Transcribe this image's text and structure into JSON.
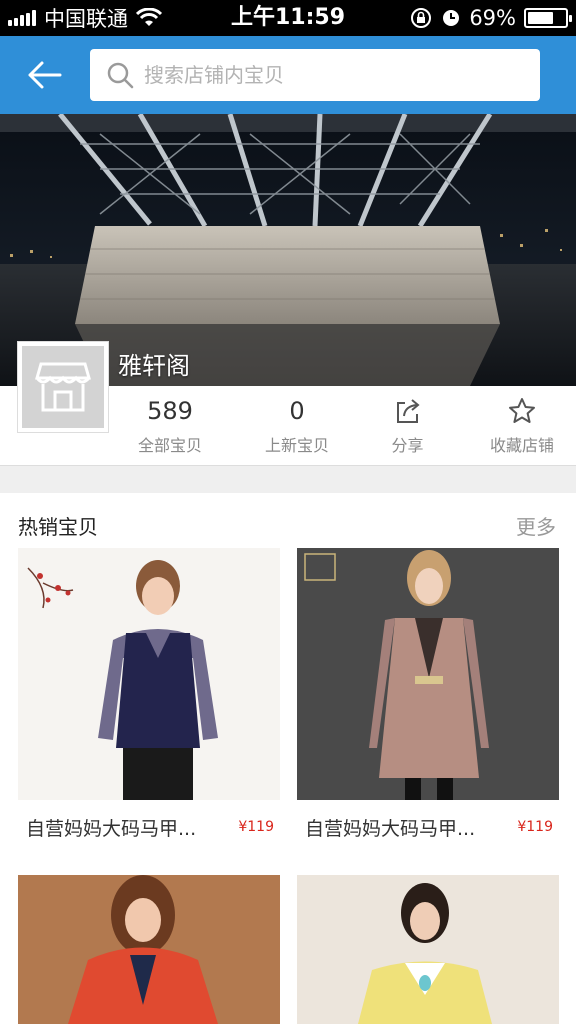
{
  "status_bar": {
    "carrier": "中国联通",
    "time": "上午11:59",
    "battery": "69%",
    "battery_level": 0.69,
    "icons": [
      "signal-icon",
      "wifi-icon",
      "rotation-lock-icon",
      "alarm-icon",
      "battery-icon"
    ]
  },
  "header": {
    "search_placeholder": "搜索店铺内宝贝",
    "colors": {
      "bar": "#2f8fd8"
    }
  },
  "shop": {
    "name": "雅轩阁"
  },
  "stats": [
    {
      "value": "589",
      "label": "全部宝贝"
    },
    {
      "value": "0",
      "label": "上新宝贝"
    },
    {
      "label": "分享",
      "icon": "share-icon"
    },
    {
      "label": "收藏店铺",
      "icon": "star-icon"
    }
  ],
  "hot": {
    "title": "热销宝贝",
    "more": "更多",
    "products": [
      {
        "title": "自营妈妈大码马甲...",
        "price": "¥119"
      },
      {
        "title": "自营妈妈大码马甲...",
        "price": "¥119"
      }
    ]
  },
  "colors": {
    "price": "#d9261c",
    "accent": "#2f8fd8"
  }
}
